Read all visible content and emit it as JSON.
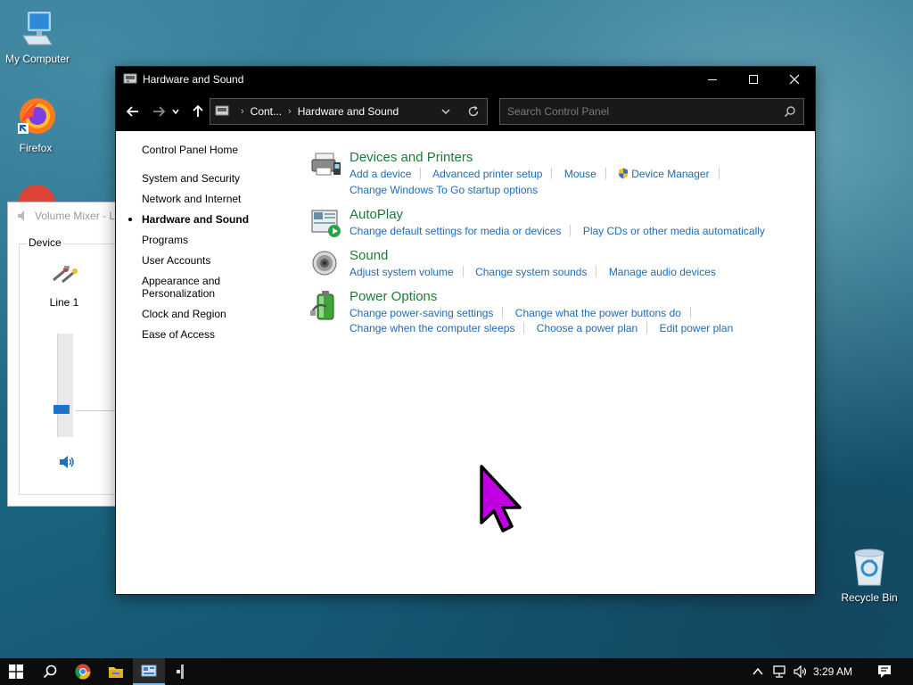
{
  "desktop": {
    "icons": [
      {
        "label": "My Computer"
      },
      {
        "label": "Firefox"
      },
      {
        "label": "Recycle Bin"
      }
    ]
  },
  "volume_mixer": {
    "title": "Volume Mixer - Li",
    "group_label": "Device",
    "device_name": "Line 1",
    "volume_level_fraction": 0.27
  },
  "control_panel": {
    "window_title": "Hardware and Sound",
    "address": {
      "crumbs": [
        "Cont...",
        "Hardware and Sound"
      ]
    },
    "search": {
      "placeholder": "Search Control Panel"
    },
    "left_nav": {
      "home": "Control Panel Home",
      "items": [
        "System and Security",
        "Network and Internet",
        "Hardware and Sound",
        "Programs",
        "User Accounts",
        "Appearance and Personalization",
        "Clock and Region",
        "Ease of Access"
      ],
      "active_index": 2
    },
    "categories": [
      {
        "title": "Devices and Printers",
        "icon": "printer-icon",
        "rows": [
          [
            "Add a device",
            "Advanced printer setup",
            "Mouse",
            "Device Manager"
          ],
          [
            "Change Windows To Go startup options"
          ]
        ]
      },
      {
        "title": "AutoPlay",
        "icon": "autoplay-icon",
        "rows": [
          [
            "Change default settings for media or devices",
            "Play CDs or other media automatically"
          ]
        ]
      },
      {
        "title": "Sound",
        "icon": "speaker-icon",
        "rows": [
          [
            "Adjust system volume",
            "Change system sounds",
            "Manage audio devices"
          ]
        ]
      },
      {
        "title": "Power Options",
        "icon": "battery-icon",
        "rows": [
          [
            "Change power-saving settings",
            "Change what the power buttons do"
          ],
          [
            "Change when the computer sleeps",
            "Choose a power plan",
            "Edit power plan"
          ]
        ]
      }
    ]
  },
  "taskbar": {
    "clock": "3:29 AM"
  },
  "colors": {
    "category_title": "#1e7a38",
    "link": "#1f6bb7",
    "titlebar": "#000000",
    "taskbar": "#0c0c0c",
    "accent": "#76b9ed",
    "cursor": "#c000e0"
  }
}
